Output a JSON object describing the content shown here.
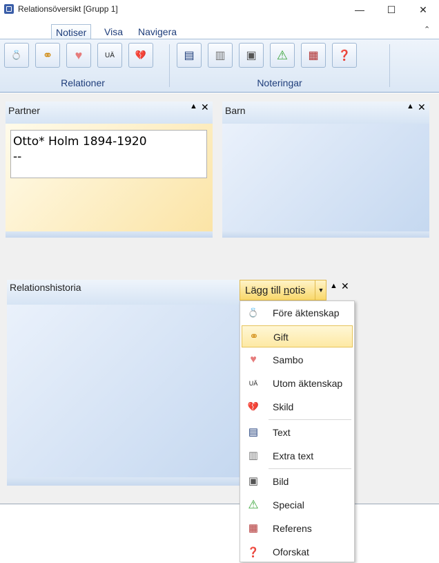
{
  "window": {
    "title": "Relationsöversikt [Grupp 1]",
    "minimize": "—",
    "maximize": "☐",
    "close": "✕"
  },
  "ribbon": {
    "tabs": [
      {
        "label": "Notiser",
        "active": true
      },
      {
        "label": "Visa",
        "active": false
      },
      {
        "label": "Navigera",
        "active": false
      }
    ],
    "collapse_glyph": "⌃",
    "groups": {
      "relationer": "Relationer",
      "noteringar": "Noteringar"
    },
    "relation_buttons": [
      {
        "icon": "ring-icon",
        "glyph": "💍"
      },
      {
        "icon": "wedding-rings-icon",
        "glyph": "⚭"
      },
      {
        "icon": "heart-face-icon",
        "glyph": "♥"
      },
      {
        "icon": "ua-icon",
        "glyph": "UÄ"
      },
      {
        "icon": "broken-heart-icon",
        "glyph": "💔"
      }
    ],
    "note_buttons": [
      {
        "icon": "text-note-icon",
        "glyph": "▤"
      },
      {
        "icon": "extra-text-icon",
        "glyph": "▥"
      },
      {
        "icon": "image-icon",
        "glyph": "▣"
      },
      {
        "icon": "warning-icon",
        "glyph": "⚠"
      },
      {
        "icon": "reference-icon",
        "glyph": "▦"
      },
      {
        "icon": "unknown-icon",
        "glyph": "❓"
      }
    ]
  },
  "panes": {
    "partner": {
      "title": "Partner",
      "card_line1": "Otto* Holm 1894-1920",
      "card_line2": "--"
    },
    "barn": {
      "title": "Barn"
    },
    "historia": {
      "title": "Relationshistoria"
    },
    "up_glyph": "▲",
    "close_glyph": "✕"
  },
  "add_note": {
    "label_pre": "Lägg till ",
    "label_underlined": "n",
    "label_post": "otis",
    "arrow": "▼",
    "menu": [
      {
        "label": "Före äktenskap",
        "glyph": "💍",
        "icon": "ring-icon",
        "highlighted": false
      },
      {
        "label": "Gift",
        "glyph": "⚭",
        "icon": "wedding-rings-icon",
        "highlighted": true
      },
      {
        "label": "Sambo",
        "glyph": "♥",
        "icon": "heart-face-icon",
        "highlighted": false
      },
      {
        "label": "Utom äktenskap",
        "glyph": "UÄ",
        "icon": "ua-icon",
        "highlighted": false
      },
      {
        "label": "Skild",
        "glyph": "💔",
        "icon": "broken-heart-icon",
        "highlighted": false
      },
      {
        "label": "Text",
        "glyph": "▤",
        "icon": "text-note-icon",
        "highlighted": false
      },
      {
        "label": "Extra text",
        "glyph": "▥",
        "icon": "extra-text-icon",
        "highlighted": false
      },
      {
        "label": "Bild",
        "glyph": "▣",
        "icon": "image-icon",
        "highlighted": false
      },
      {
        "label": "Special",
        "glyph": "⚠",
        "icon": "warning-icon",
        "highlighted": false
      },
      {
        "label": "Referens",
        "glyph": "▦",
        "icon": "reference-icon",
        "highlighted": false
      },
      {
        "label": "Oforskat",
        "glyph": "❓",
        "icon": "unknown-icon",
        "highlighted": false
      }
    ]
  },
  "colors": {
    "accent_text": "#1e3d7a",
    "highlight": "#fde9a4",
    "green_warning": "#3aa53a"
  }
}
